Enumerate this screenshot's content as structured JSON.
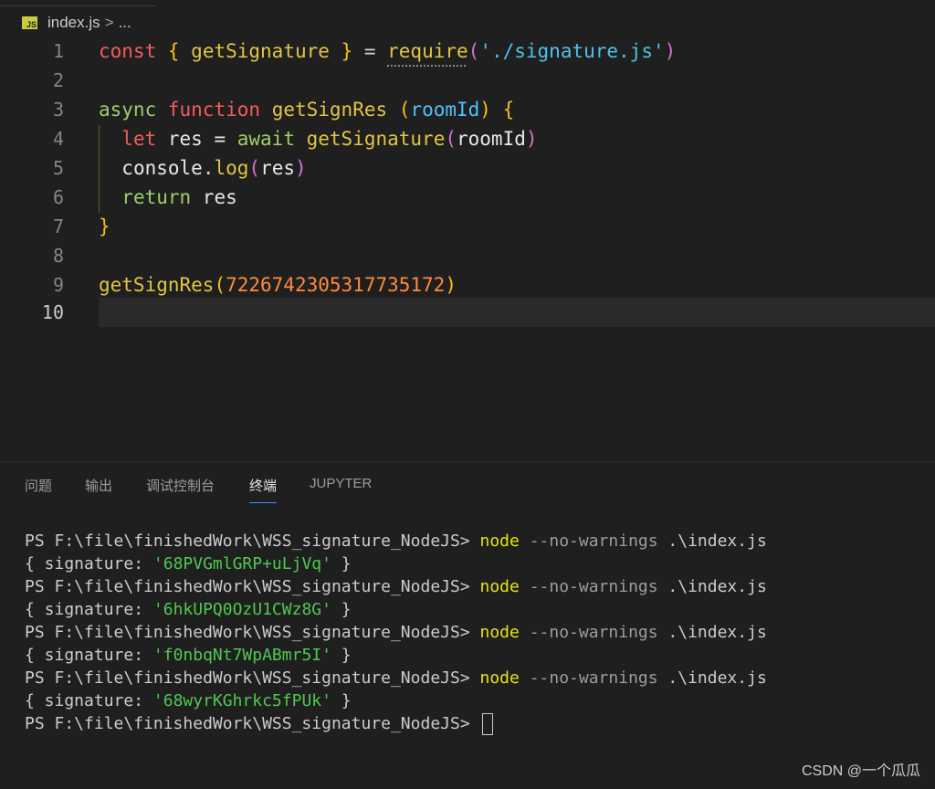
{
  "breadcrumb": {
    "badge": "JS",
    "file": "index.js",
    "separator": ">",
    "more": "..."
  },
  "editor": {
    "line_numbers": [
      "1",
      "2",
      "3",
      "4",
      "5",
      "6",
      "7",
      "8",
      "9",
      "10"
    ],
    "active_line": "10",
    "lines": {
      "l1": {
        "kw": "const",
        "ob": "{",
        "name": " getSignature ",
        "cb": "}",
        "eq": " = ",
        "req": "require",
        "op": "(",
        "str": "'./signature.js'",
        "cp": ")"
      },
      "l3": {
        "async": "async",
        "func": "function",
        "name": "getSignRes",
        "op": "(",
        "param": "roomId",
        "cp": ")",
        "brace": "{"
      },
      "l4": {
        "let": "let",
        "var": " res = ",
        "await": "await",
        "call": "getSignature",
        "op": "(",
        "arg": "roomId",
        "cp": ")"
      },
      "l5": {
        "obj": "console",
        "dot": ".",
        "method": "log",
        "op": "(",
        "arg": "res",
        "cp": ")"
      },
      "l6": {
        "ret": "return",
        "var": " res"
      },
      "l7": {
        "brace": "}"
      },
      "l9": {
        "call": "getSignRes",
        "op": "(",
        "num": "7226742305317735172",
        "cp": ")"
      }
    }
  },
  "panel": {
    "tabs": [
      "问题",
      "输出",
      "调试控制台",
      "终端",
      "JUPYTER"
    ],
    "active_tab": "终端"
  },
  "terminal": {
    "prompt": "PS F:\\file\\finishedWork\\WSS_signature_NodeJS> ",
    "cmd": "node",
    "flag": " --no-warnings",
    "arg": " .\\index.js",
    "out_prefix": "{ signature: ",
    "out_suffix": " }",
    "signatures": [
      "'68PVGmlGRP+uLjVq'",
      "'6hkUPQ0OzU1CWz8G'",
      "'f0nbqNt7WpABmr5I'",
      "'68wyrKGhrkc5fPUk'"
    ]
  },
  "watermark": "CSDN @一个瓜瓜",
  "colors": {
    "background": "#1f1f1f",
    "keyword": "#f25c5c",
    "function": "#e2c541",
    "string": "#4fc1e9",
    "number": "#ff8a3c",
    "terminal_cmd": "#e5e510",
    "terminal_string": "#4ec94e",
    "tab_underline": "#3794ff"
  }
}
